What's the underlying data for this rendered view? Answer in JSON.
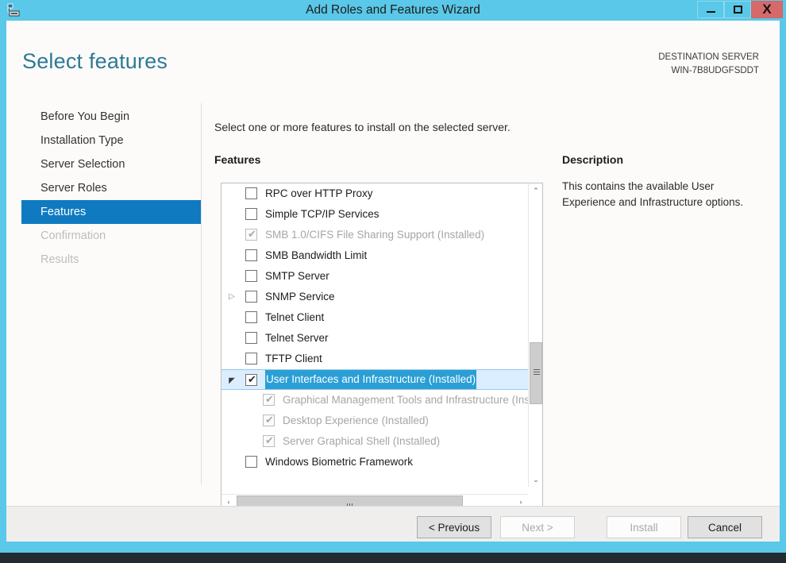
{
  "window": {
    "title": "Add Roles and Features Wizard",
    "icon": "server-manager-icon",
    "minimize_label": "",
    "maximize_label": "",
    "close_label": "X",
    "titlebar_color": "#5ac8e8",
    "close_color": "#d66a6a"
  },
  "header": {
    "page_title": "Select features",
    "destination_label": "DESTINATION SERVER",
    "destination_server": "WIN-7B8UDGFSDDT"
  },
  "sidebar": {
    "items": [
      {
        "label": "Before You Begin",
        "state": "normal"
      },
      {
        "label": "Installation Type",
        "state": "normal"
      },
      {
        "label": "Server Selection",
        "state": "normal"
      },
      {
        "label": "Server Roles",
        "state": "normal"
      },
      {
        "label": "Features",
        "state": "selected"
      },
      {
        "label": "Confirmation",
        "state": "disabled"
      },
      {
        "label": "Results",
        "state": "disabled"
      }
    ],
    "selected_color": "#0f7ac0"
  },
  "main": {
    "instruction": "Select one or more features to install on the selected server.",
    "features_label": "Features",
    "description_label": "Description",
    "description_text": "This contains the available User Experience and Infrastructure options."
  },
  "features": [
    {
      "label": "RPC over HTTP Proxy",
      "level": 0,
      "checked": false,
      "installed": false,
      "twisty": "",
      "selected": false
    },
    {
      "label": "Simple TCP/IP Services",
      "level": 0,
      "checked": false,
      "installed": false,
      "twisty": "",
      "selected": false
    },
    {
      "label": "SMB 1.0/CIFS File Sharing Support (Installed)",
      "level": 0,
      "checked": true,
      "installed": true,
      "twisty": "",
      "selected": false
    },
    {
      "label": "SMB Bandwidth Limit",
      "level": 0,
      "checked": false,
      "installed": false,
      "twisty": "",
      "selected": false
    },
    {
      "label": "SMTP Server",
      "level": 0,
      "checked": false,
      "installed": false,
      "twisty": "",
      "selected": false
    },
    {
      "label": "SNMP Service",
      "level": 0,
      "checked": false,
      "installed": false,
      "twisty": "collapsed",
      "selected": false
    },
    {
      "label": "Telnet Client",
      "level": 0,
      "checked": false,
      "installed": false,
      "twisty": "",
      "selected": false
    },
    {
      "label": "Telnet Server",
      "level": 0,
      "checked": false,
      "installed": false,
      "twisty": "",
      "selected": false
    },
    {
      "label": "TFTP Client",
      "level": 0,
      "checked": false,
      "installed": false,
      "twisty": "",
      "selected": false
    },
    {
      "label": "User Interfaces and Infrastructure (Installed)",
      "level": 0,
      "checked": true,
      "installed": false,
      "twisty": "expanded",
      "selected": true
    },
    {
      "label": "Graphical Management Tools and Infrastructure (Installed)",
      "level": 1,
      "checked": true,
      "installed": true,
      "twisty": "",
      "selected": false
    },
    {
      "label": "Desktop Experience (Installed)",
      "level": 1,
      "checked": true,
      "installed": true,
      "twisty": "",
      "selected": false
    },
    {
      "label": "Server Graphical Shell (Installed)",
      "level": 1,
      "checked": true,
      "installed": true,
      "twisty": "",
      "selected": false
    },
    {
      "label": "Windows Biometric Framework",
      "level": 0,
      "checked": false,
      "installed": false,
      "twisty": "",
      "selected": false
    }
  ],
  "scrollbars": {
    "vertical_up": "⌃",
    "vertical_down": "⌄",
    "horizontal_left": "‹",
    "horizontal_right": "›"
  },
  "footer": {
    "previous_label": "< Previous",
    "next_label": "Next >",
    "install_label": "Install",
    "cancel_label": "Cancel",
    "previous_enabled": true,
    "next_enabled": false,
    "install_enabled": false,
    "cancel_enabled": true
  }
}
